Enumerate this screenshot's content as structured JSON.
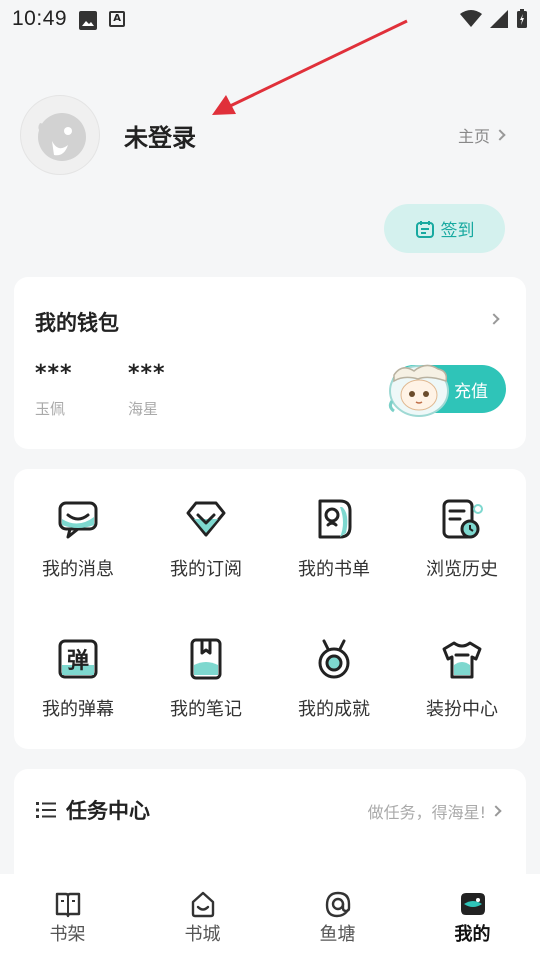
{
  "status_bar": {
    "time": "10:49",
    "icons": [
      "image-icon",
      "a-icon",
      "wifi-icon",
      "signal-icon",
      "battery-icon"
    ]
  },
  "profile": {
    "name": "未登录",
    "homepage_label": "主页"
  },
  "signin": {
    "label": "签到"
  },
  "wallet": {
    "title": "我的钱包",
    "balances": [
      {
        "value": "***",
        "label": "玉佩"
      },
      {
        "value": "***",
        "label": "海星"
      }
    ],
    "recharge_label": "充值"
  },
  "menu": {
    "items": [
      {
        "label": "我的消息",
        "icon": "message-icon"
      },
      {
        "label": "我的订阅",
        "icon": "subscribe-icon"
      },
      {
        "label": "我的书单",
        "icon": "booklist-icon"
      },
      {
        "label": "浏览历史",
        "icon": "history-icon"
      },
      {
        "label": "我的弹幕",
        "icon": "danmaku-icon",
        "glyph": "弹"
      },
      {
        "label": "我的笔记",
        "icon": "notes-icon"
      },
      {
        "label": "我的成就",
        "icon": "achievement-icon"
      },
      {
        "label": "装扮中心",
        "icon": "dressup-icon"
      }
    ]
  },
  "tasks": {
    "title": "任务中心",
    "hint": "做任务，得海星!"
  },
  "bottom_nav": {
    "items": [
      {
        "label": "书架",
        "icon": "bookshelf-icon",
        "active": false
      },
      {
        "label": "书城",
        "icon": "bookstore-icon",
        "active": false
      },
      {
        "label": "鱼塘",
        "icon": "fishpond-icon",
        "active": false
      },
      {
        "label": "我的",
        "icon": "mine-icon",
        "active": true
      }
    ]
  },
  "colors": {
    "accent": "#2fc4b8",
    "accent_light": "#d4f1ee",
    "annotation_arrow": "#e0303a"
  }
}
